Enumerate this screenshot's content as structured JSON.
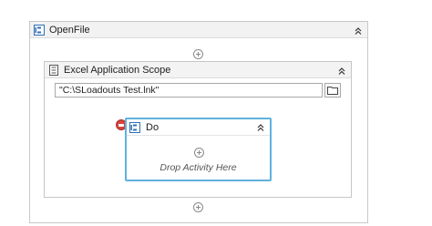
{
  "workflow": {
    "openfile": {
      "title": "OpenFile"
    },
    "excel_scope": {
      "title": "Excel Application Scope",
      "path_value": "\"C:\\SLoadouts Test.lnk\""
    },
    "do_sequence": {
      "title": "Do",
      "drop_hint": "Drop Activity Here"
    }
  },
  "icons": {
    "sequence": "sequence-icon",
    "excel": "excel-document-icon",
    "collapse": "chevron-double-up-icon",
    "add": "plus-circle-icon",
    "browse": "folder-icon",
    "error": "error-icon"
  },
  "colors": {
    "selection_border": "#5fb2dc",
    "sequence_icon": "#2f6fb7",
    "error": "#d8453d"
  }
}
